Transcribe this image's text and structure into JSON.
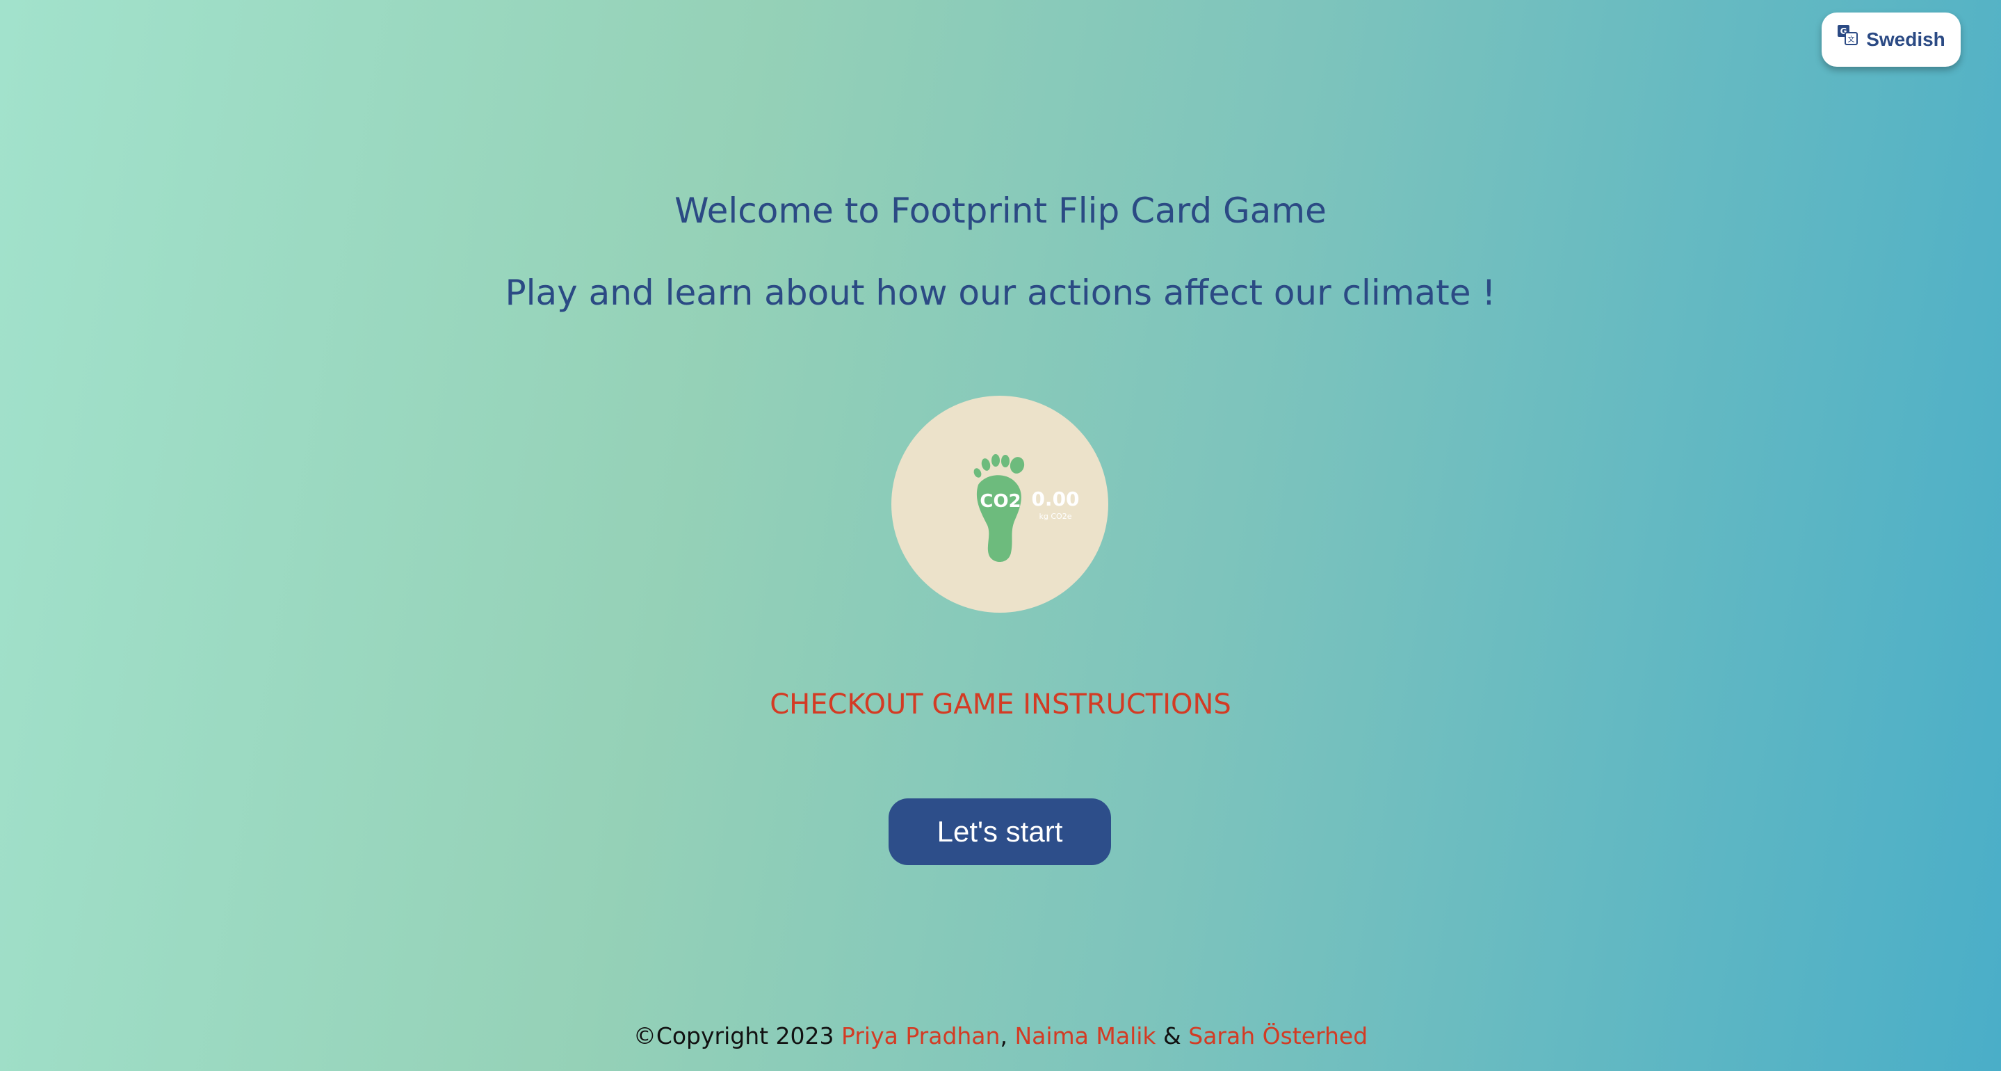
{
  "language_button": {
    "label": "Swedish",
    "icon": "translate-icon"
  },
  "header": {
    "title": "Welcome to Footprint Flip Card Game",
    "subtitle": "Play and learn about how our actions affect our climate !"
  },
  "logo": {
    "icon": "footprint-icon",
    "footprint_text": "CO2",
    "value": "0.00",
    "unit": "kg CO2e"
  },
  "instructions_link": "CHECKOUT GAME INSTRUCTIONS",
  "start_button": "Let's start",
  "footer": {
    "copyright": "©Copyright 2023",
    "authors": [
      "Priya Pradhan",
      "Naima Malik",
      "Sarah Österhed"
    ],
    "separator_1": ",",
    "separator_2": "&"
  },
  "colors": {
    "heading": "#2b4a84",
    "accent": "#d33b24",
    "button": "#2d4e8a",
    "logo_bg": "#ece2ca",
    "footprint": "#6dbb7d"
  }
}
